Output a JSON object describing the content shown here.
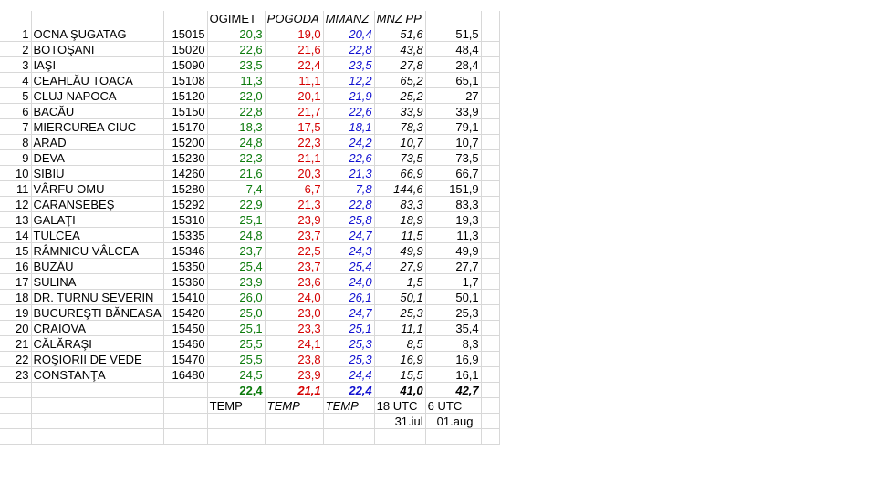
{
  "headers": {
    "ogimet": "OGIMET",
    "pogoda": "POGODA",
    "mmanz": "MMANZ",
    "mnzpp": "MNZ PP"
  },
  "rows": [
    {
      "n": "1",
      "station": "OCNA ŞUGATAG",
      "code": "15015",
      "ogimet": "20,3",
      "pogoda": "19,0",
      "mmanz": "20,4",
      "mnzpp": "51,6",
      "obs": "51,5"
    },
    {
      "n": "2",
      "station": "BOTOŞANI",
      "code": "15020",
      "ogimet": "22,6",
      "pogoda": "21,6",
      "mmanz": "22,8",
      "mnzpp": "43,8",
      "obs": "48,4"
    },
    {
      "n": "3",
      "station": "IAŞI",
      "code": "15090",
      "ogimet": "23,5",
      "pogoda": "22,4",
      "mmanz": "23,5",
      "mnzpp": "27,8",
      "obs": "28,4"
    },
    {
      "n": "4",
      "station": "CEAHLĂU TOACA",
      "code": "15108",
      "ogimet": "11,3",
      "pogoda": "11,1",
      "mmanz": "12,2",
      "mnzpp": "65,2",
      "obs": "65,1"
    },
    {
      "n": "5",
      "station": "CLUJ NAPOCA",
      "code": "15120",
      "ogimet": "22,0",
      "pogoda": "20,1",
      "mmanz": "21,9",
      "mnzpp": "25,2",
      "obs": "27"
    },
    {
      "n": "6",
      "station": "BACĂU",
      "code": "15150",
      "ogimet": "22,8",
      "pogoda": "21,7",
      "mmanz": "22,6",
      "mnzpp": "33,9",
      "obs": "33,9"
    },
    {
      "n": "7",
      "station": "MIERCUREA CIUC",
      "code": "15170",
      "ogimet": "18,3",
      "pogoda": "17,5",
      "mmanz": "18,1",
      "mnzpp": "78,3",
      "obs": "79,1"
    },
    {
      "n": "8",
      "station": "ARAD",
      "code": "15200",
      "ogimet": "24,8",
      "pogoda": "22,3",
      "mmanz": "24,2",
      "mnzpp": "10,7",
      "obs": "10,7"
    },
    {
      "n": "9",
      "station": "DEVA",
      "code": "15230",
      "ogimet": "22,3",
      "pogoda": "21,1",
      "mmanz": "22,6",
      "mnzpp": "73,5",
      "obs": "73,5"
    },
    {
      "n": "10",
      "station": "SIBIU",
      "code": "14260",
      "ogimet": "21,6",
      "pogoda": "20,3",
      "mmanz": "21,3",
      "mnzpp": "66,9",
      "obs": "66,7"
    },
    {
      "n": "11",
      "station": "VÂRFU OMU",
      "code": "15280",
      "ogimet": "7,4",
      "pogoda": "6,7",
      "mmanz": "7,8",
      "mnzpp": "144,6",
      "obs": "151,9"
    },
    {
      "n": "12",
      "station": "CARANSEBEŞ",
      "code": "15292",
      "ogimet": "22,9",
      "pogoda": "21,3",
      "mmanz": "22,8",
      "mnzpp": "83,3",
      "obs": "83,3"
    },
    {
      "n": "13",
      "station": "GALAŢI",
      "code": "15310",
      "ogimet": "25,1",
      "pogoda": "23,9",
      "mmanz": "25,8",
      "mnzpp": "18,9",
      "obs": "19,3"
    },
    {
      "n": "14",
      "station": "TULCEA",
      "code": "15335",
      "ogimet": "24,8",
      "pogoda": "23,7",
      "mmanz": "24,7",
      "mnzpp": "11,5",
      "obs": "11,3"
    },
    {
      "n": "15",
      "station": "RÂMNICU VÂLCEA",
      "code": "15346",
      "ogimet": "23,7",
      "pogoda": "22,5",
      "mmanz": "24,3",
      "mnzpp": "49,9",
      "obs": "49,9"
    },
    {
      "n": "16",
      "station": "BUZĂU",
      "code": "15350",
      "ogimet": "25,4",
      "pogoda": "23,7",
      "mmanz": "25,4",
      "mnzpp": "27,9",
      "obs": "27,7"
    },
    {
      "n": "17",
      "station": "SULINA",
      "code": "15360",
      "ogimet": "23,9",
      "pogoda": "23,6",
      "mmanz": "24,0",
      "mnzpp": "1,5",
      "obs": "1,7"
    },
    {
      "n": "18",
      "station": "DR. TURNU SEVERIN",
      "code": "15410",
      "ogimet": "26,0",
      "pogoda": "24,0",
      "mmanz": "26,1",
      "mnzpp": "50,1",
      "obs": "50,1"
    },
    {
      "n": "19",
      "station": "BUCUREŞTI BĂNEASA",
      "code": "15420",
      "ogimet": "25,0",
      "pogoda": "23,0",
      "mmanz": "24,7",
      "mnzpp": "25,3",
      "obs": "25,3"
    },
    {
      "n": "20",
      "station": "CRAIOVA",
      "code": "15450",
      "ogimet": "25,1",
      "pogoda": "23,3",
      "mmanz": "25,1",
      "mnzpp": "11,1",
      "obs": "35,4"
    },
    {
      "n": "21",
      "station": "CĂLĂRAŞI",
      "code": "15460",
      "ogimet": "25,5",
      "pogoda": "24,1",
      "mmanz": "25,3",
      "mnzpp": "8,5",
      "obs": "8,3"
    },
    {
      "n": "22",
      "station": "ROŞIORII DE VEDE",
      "code": "15470",
      "ogimet": "25,5",
      "pogoda": "23,8",
      "mmanz": "25,3",
      "mnzpp": "16,9",
      "obs": "16,9"
    },
    {
      "n": "23",
      "station": "CONSTANŢA",
      "code": "16480",
      "ogimet": "24,5",
      "pogoda": "23,9",
      "mmanz": "24,4",
      "mnzpp": "15,5",
      "obs": "16,1"
    }
  ],
  "averages": {
    "ogimet": "22,4",
    "pogoda": "21,1",
    "mmanz": "22,4",
    "mnzpp": "41,0",
    "obs": "42,7"
  },
  "footer": {
    "temp_ogimet": "TEMP",
    "temp_pogoda": "TEMP",
    "temp_mmanz": "TEMP",
    "utc_18": "18 UTC",
    "utc_6": "6 UTC",
    "date_1": "31.iul",
    "date_2": "01.aug"
  },
  "colors": {
    "ogimet": "#0c7a0c",
    "pogoda": "#d40000",
    "mmanz": "#1010d0"
  }
}
